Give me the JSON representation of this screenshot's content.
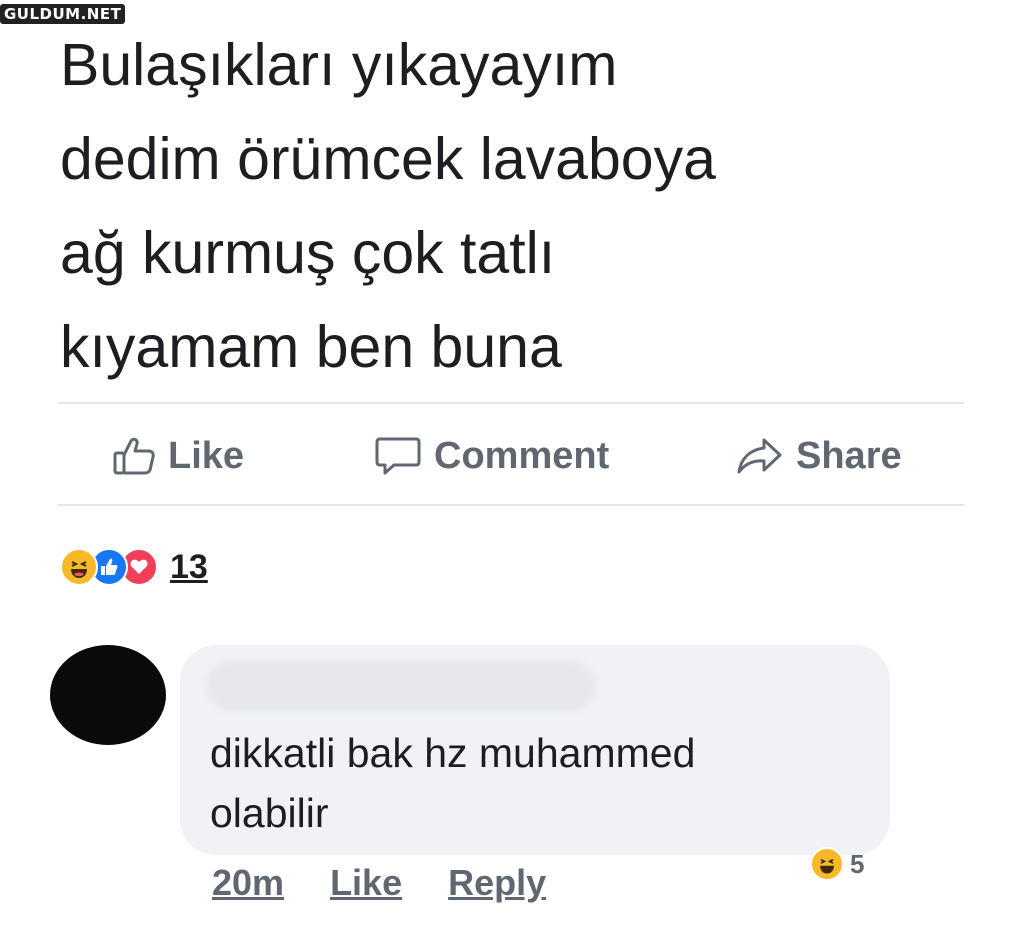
{
  "watermark": "GULDUM.NET",
  "post": {
    "lines": [
      "Bulaşıkları yıkayayım",
      "dedim örümcek lavaboya",
      "ağ kurmuş çok tatlı",
      "kıyamam ben buna"
    ]
  },
  "actions": {
    "like": "Like",
    "comment": "Comment",
    "share": "Share"
  },
  "reactions": {
    "icons": [
      "haha-icon",
      "like-icon",
      "love-icon"
    ],
    "count": "13"
  },
  "comment": {
    "lines": [
      "dikkatli bak hz muhammed",
      "olabilir"
    ],
    "time": "20m",
    "like": "Like",
    "reply": "Reply",
    "reaction_count": "5"
  },
  "colors": {
    "action_gray": "#606770",
    "like_blue": "#1877f2",
    "love_red": "#f33e58",
    "haha_yellow": "#f7b928",
    "bubble_bg": "#f0f2f5"
  }
}
